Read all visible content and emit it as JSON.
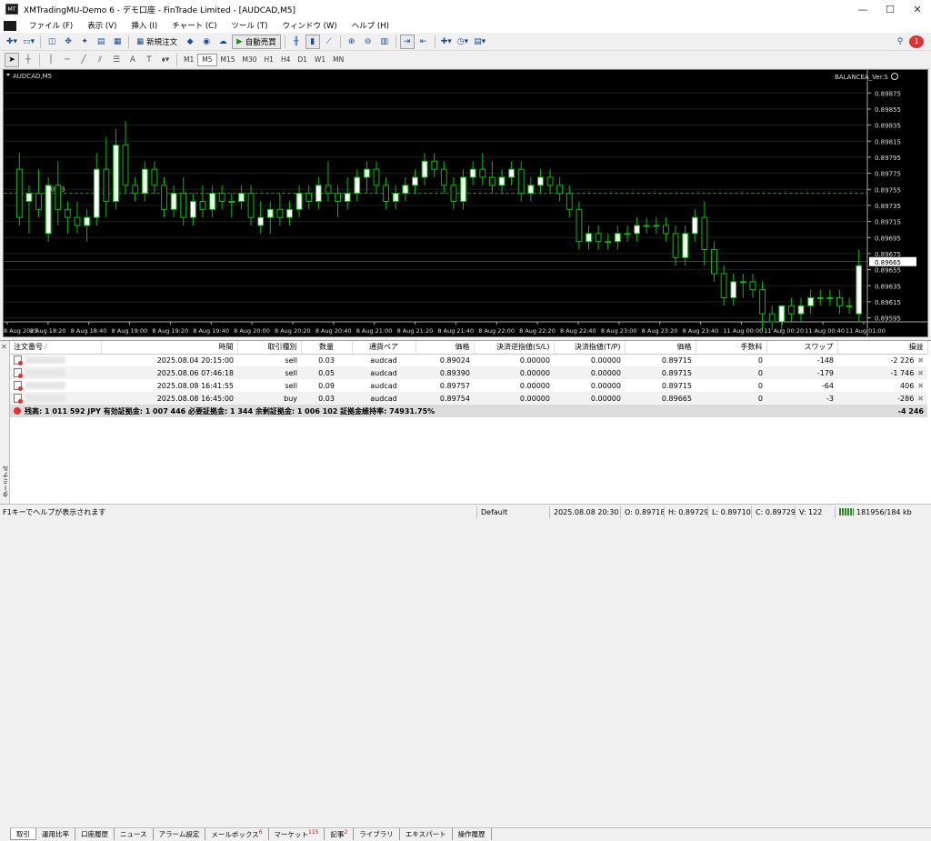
{
  "window": {
    "title": "XMTradingMU-Demo 6 - デモ口座 - FinTrade Limited - [AUDCAD,M5]",
    "minimize": "—",
    "maximize": "☐",
    "close": "✕"
  },
  "menu": [
    "ファイル (F)",
    "表示 (V)",
    "挿入 (I)",
    "チャート (C)",
    "ツール (T)",
    "ウィンドウ (W)",
    "ヘルプ (H)"
  ],
  "toolbar": {
    "new_order": "新規注文",
    "auto_trading": "自動売買",
    "notification_count": "1"
  },
  "timeframes": [
    "M1",
    "M5",
    "M15",
    "M30",
    "H1",
    "H4",
    "D1",
    "W1",
    "MN"
  ],
  "active_timeframe": "M5",
  "chart": {
    "symbol_label": "AUDCAD,M5",
    "ea_label": "BALANCEA_Ver.S",
    "current_price": "0.89665",
    "price_ticks": [
      "0.89875",
      "0.89855",
      "0.89835",
      "0.89815",
      "0.89795",
      "0.89775",
      "0.89755",
      "0.89735",
      "0.89715",
      "0.89695",
      "0.89675",
      "0.89655",
      "0.89635",
      "0.89615",
      "0.89595"
    ],
    "time_ticks": [
      "8 Aug 2025",
      "8 Aug 18:20",
      "8 Aug 18:40",
      "8 Aug 19:00",
      "8 Aug 19:20",
      "8 Aug 19:40",
      "8 Aug 20:00",
      "8 Aug 20:20",
      "8 Aug 20:40",
      "8 Aug 21:00",
      "8 Aug 21:20",
      "8 Aug 21:40",
      "8 Aug 22:00",
      "8 Aug 22:20",
      "8 Aug 22:40",
      "8 Aug 23:00",
      "8 Aug 23:20",
      "8 Aug 23:40",
      "11 Aug 00:00",
      "11 Aug 00:20",
      "11 Aug 00:40",
      "11 Aug 01:00"
    ],
    "order_line_label": "0.03",
    "colors": {
      "background": "#000000",
      "bull": "#ffffff",
      "bear": "#000000",
      "wick": "#00c000",
      "grid": "#1e1e1e",
      "order_line": "#3a7a3a"
    }
  },
  "chart_data": {
    "type": "candlestick",
    "symbol": "AUDCAD",
    "timeframe": "M5",
    "ylim": [
      0.8959,
      0.8989
    ],
    "candles": [
      [
        0.8978,
        0.898,
        0.8971,
        0.8972
      ],
      [
        0.8974,
        0.8976,
        0.897,
        0.8975
      ],
      [
        0.8975,
        0.8978,
        0.8972,
        0.8973
      ],
      [
        0.897,
        0.8977,
        0.8969,
        0.8976
      ],
      [
        0.8976,
        0.8979,
        0.8971,
        0.8973
      ],
      [
        0.8973,
        0.8974,
        0.897,
        0.8972
      ],
      [
        0.8972,
        0.8974,
        0.897,
        0.8971
      ],
      [
        0.8971,
        0.8973,
        0.8969,
        0.8972
      ],
      [
        0.8972,
        0.898,
        0.8971,
        0.8978
      ],
      [
        0.8978,
        0.8982,
        0.8972,
        0.8974
      ],
      [
        0.8974,
        0.8983,
        0.8973,
        0.8981
      ],
      [
        0.8981,
        0.8984,
        0.8975,
        0.8976
      ],
      [
        0.8976,
        0.8977,
        0.8974,
        0.8975
      ],
      [
        0.8975,
        0.8979,
        0.8974,
        0.8978
      ],
      [
        0.8978,
        0.8979,
        0.8975,
        0.8976
      ],
      [
        0.8976,
        0.8977,
        0.8972,
        0.8973
      ],
      [
        0.8973,
        0.8976,
        0.8972,
        0.8975
      ],
      [
        0.8975,
        0.8977,
        0.8971,
        0.8972
      ],
      [
        0.8972,
        0.8975,
        0.8971,
        0.8974
      ],
      [
        0.8974,
        0.8976,
        0.8972,
        0.8973
      ],
      [
        0.8973,
        0.8976,
        0.8972,
        0.8975
      ],
      [
        0.8975,
        0.8976,
        0.8973,
        0.8974
      ],
      [
        0.8974,
        0.8975,
        0.8972,
        0.8974
      ],
      [
        0.8974,
        0.8976,
        0.8973,
        0.8975
      ],
      [
        0.8975,
        0.8976,
        0.8971,
        0.8972
      ],
      [
        0.8971,
        0.8974,
        0.897,
        0.8972
      ],
      [
        0.8972,
        0.8974,
        0.897,
        0.8973
      ],
      [
        0.8973,
        0.8975,
        0.8971,
        0.8972
      ],
      [
        0.8972,
        0.8974,
        0.8971,
        0.8973
      ],
      [
        0.8973,
        0.8976,
        0.8972,
        0.8975
      ],
      [
        0.8975,
        0.8976,
        0.8973,
        0.8974
      ],
      [
        0.8974,
        0.8977,
        0.8973,
        0.8976
      ],
      [
        0.8976,
        0.8979,
        0.8974,
        0.8975
      ],
      [
        0.8975,
        0.8976,
        0.8972,
        0.8974
      ],
      [
        0.8974,
        0.8977,
        0.8973,
        0.8975
      ],
      [
        0.8975,
        0.8978,
        0.8974,
        0.8977
      ],
      [
        0.8977,
        0.8979,
        0.8975,
        0.8978
      ],
      [
        0.8978,
        0.8979,
        0.8975,
        0.8976
      ],
      [
        0.8976,
        0.8977,
        0.8973,
        0.8974
      ],
      [
        0.8974,
        0.8976,
        0.8973,
        0.8975
      ],
      [
        0.8975,
        0.8977,
        0.8974,
        0.8976
      ],
      [
        0.8976,
        0.8978,
        0.8975,
        0.8977
      ],
      [
        0.8977,
        0.898,
        0.8976,
        0.8979
      ],
      [
        0.8979,
        0.898,
        0.8977,
        0.8978
      ],
      [
        0.8978,
        0.8979,
        0.8975,
        0.8976
      ],
      [
        0.8976,
        0.8977,
        0.8973,
        0.8974
      ],
      [
        0.8974,
        0.8978,
        0.8973,
        0.8977
      ],
      [
        0.8977,
        0.8979,
        0.8976,
        0.8978
      ],
      [
        0.8978,
        0.898,
        0.8976,
        0.8977
      ],
      [
        0.8977,
        0.8979,
        0.8975,
        0.8976
      ],
      [
        0.8976,
        0.8978,
        0.8975,
        0.8977
      ],
      [
        0.8977,
        0.8979,
        0.8976,
        0.8978
      ],
      [
        0.8978,
        0.8979,
        0.8974,
        0.8975
      ],
      [
        0.8975,
        0.8977,
        0.8974,
        0.8976
      ],
      [
        0.8976,
        0.8978,
        0.8975,
        0.8977
      ],
      [
        0.8977,
        0.8978,
        0.8975,
        0.8976
      ],
      [
        0.8976,
        0.8977,
        0.8974,
        0.8975
      ],
      [
        0.8975,
        0.8976,
        0.8972,
        0.8973
      ],
      [
        0.8973,
        0.8974,
        0.8968,
        0.8969
      ],
      [
        0.8969,
        0.8971,
        0.8968,
        0.897
      ],
      [
        0.897,
        0.8971,
        0.8968,
        0.8969
      ],
      [
        0.8969,
        0.897,
        0.8968,
        0.8969
      ],
      [
        0.8969,
        0.8971,
        0.8968,
        0.897
      ],
      [
        0.897,
        0.8971,
        0.8969,
        0.897
      ],
      [
        0.897,
        0.8972,
        0.8969,
        0.8971
      ],
      [
        0.8971,
        0.8972,
        0.897,
        0.8971
      ],
      [
        0.8971,
        0.8972,
        0.897,
        0.8971
      ],
      [
        0.8971,
        0.8972,
        0.8969,
        0.897
      ],
      [
        0.897,
        0.8971,
        0.8966,
        0.8967
      ],
      [
        0.8967,
        0.8971,
        0.8966,
        0.897
      ],
      [
        0.897,
        0.8973,
        0.8969,
        0.8972
      ],
      [
        0.8972,
        0.8974,
        0.8966,
        0.8968
      ],
      [
        0.8968,
        0.8969,
        0.8964,
        0.8965
      ],
      [
        0.8965,
        0.8966,
        0.8961,
        0.8962
      ],
      [
        0.8962,
        0.8965,
        0.8961,
        0.8964
      ],
      [
        0.8964,
        0.8965,
        0.8962,
        0.8964
      ],
      [
        0.8964,
        0.8965,
        0.8962,
        0.8963
      ],
      [
        0.8963,
        0.8964,
        0.8958,
        0.896
      ],
      [
        0.896,
        0.8961,
        0.8958,
        0.8959
      ],
      [
        0.8959,
        0.8961,
        0.8958,
        0.8961
      ],
      [
        0.8961,
        0.8962,
        0.8959,
        0.896
      ],
      [
        0.896,
        0.8962,
        0.8959,
        0.8961
      ],
      [
        0.8961,
        0.8963,
        0.896,
        0.8962
      ],
      [
        0.8962,
        0.8963,
        0.8961,
        0.8962
      ],
      [
        0.8962,
        0.8963,
        0.8961,
        0.8962
      ],
      [
        0.8962,
        0.8963,
        0.896,
        0.8961
      ],
      [
        0.8961,
        0.8962,
        0.896,
        0.8961
      ],
      [
        0.896,
        0.8968,
        0.8959,
        0.8966
      ]
    ]
  },
  "orders": {
    "columns": [
      "注文番号",
      "時間",
      "取引種別",
      "数量",
      "通貨ペア",
      "価格",
      "決済逆指値(S/L)",
      "決済指値(T/P)",
      "価格",
      "手数料",
      "スワップ",
      "損益"
    ],
    "rows": [
      {
        "time": "2025.08.04 20:15:00",
        "type": "sell",
        "size": "0.03",
        "symbol": "audcad",
        "price": "0.89024",
        "sl": "0.00000",
        "tp": "0.00000",
        "cur": "0.89715",
        "comm": "0",
        "swap": "-148",
        "profit": "-2 226"
      },
      {
        "time": "2025.08.06 07:46:18",
        "type": "sell",
        "size": "0.05",
        "symbol": "audcad",
        "price": "0.89390",
        "sl": "0.00000",
        "tp": "0.00000",
        "cur": "0.89715",
        "comm": "0",
        "swap": "-179",
        "profit": "-1 746"
      },
      {
        "time": "2025.08.08 16:41:55",
        "type": "sell",
        "size": "0.09",
        "symbol": "audcad",
        "price": "0.89757",
        "sl": "0.00000",
        "tp": "0.00000",
        "cur": "0.89715",
        "comm": "0",
        "swap": "-64",
        "profit": "406"
      },
      {
        "time": "2025.08.08 16:45:00",
        "type": "buy",
        "size": "0.03",
        "symbol": "audcad",
        "price": "0.89754",
        "sl": "0.00000",
        "tp": "0.00000",
        "cur": "0.89665",
        "comm": "0",
        "swap": "-3",
        "profit": "-286"
      }
    ],
    "summary": "残高: 1 011 592 JPY  有効証拠金: 1 007 446  必要証拠金: 1 344  余剰証拠金: 1 006 102  証拠金維持率: 74931.75%",
    "summary_profit": "-4 246"
  },
  "terminal_label": "ターミナル",
  "tabs": [
    {
      "label": "取引",
      "badge": ""
    },
    {
      "label": "運用比率",
      "badge": ""
    },
    {
      "label": "口座履歴",
      "badge": ""
    },
    {
      "label": "ニュース",
      "badge": ""
    },
    {
      "label": "アラーム設定",
      "badge": ""
    },
    {
      "label": "メールボックス",
      "badge": "6"
    },
    {
      "label": "マーケット",
      "badge": "115"
    },
    {
      "label": "記事",
      "badge": "2"
    },
    {
      "label": "ライブラリ",
      "badge": ""
    },
    {
      "label": "エキスパート",
      "badge": ""
    },
    {
      "label": "操作履歴",
      "badge": ""
    }
  ],
  "status": {
    "help": "F1キーでヘルプが表示されます",
    "profile": "Default",
    "datetime": "2025.08.08 20:30",
    "open": "O: 0.89718",
    "high": "H: 0.89729",
    "low": "L: 0.89710",
    "close": "C: 0.89729",
    "volume": "V: 122",
    "connection": "181956/184 kb"
  }
}
